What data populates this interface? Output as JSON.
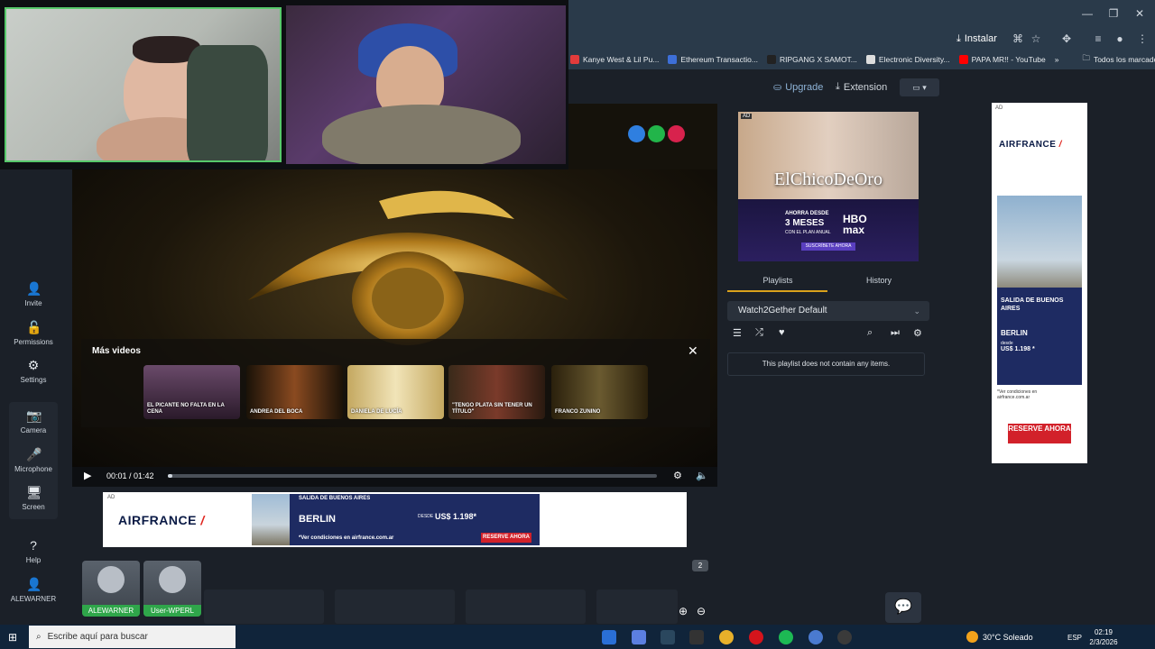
{
  "browser": {
    "install_label": "Instalar",
    "bookmarks": [
      {
        "label": "Kanye West & Lil Pu...",
        "color": "#e23b3b"
      },
      {
        "label": "Ethereum Transactio...",
        "color": "#3d6fd8"
      },
      {
        "label": "RIPGANG X SAMOT...",
        "color": "#222222"
      },
      {
        "label": "Electronic Diversity...",
        "color": "#dddddd"
      },
      {
        "label": "PAPA MR!! - YouTube",
        "color": "#ff0000"
      }
    ],
    "bookmarks_overflow": "»",
    "all_bookmarks_label": "Todos los marcadores"
  },
  "header": {
    "upgrade_label": "Upgrade",
    "extension_label": "Extension"
  },
  "sidebar": {
    "items": [
      {
        "label": "Invite",
        "icon": "add-user-icon",
        "glyph": "👤"
      },
      {
        "label": "Permissions",
        "icon": "lock-icon",
        "glyph": "🔓"
      },
      {
        "label": "Settings",
        "icon": "gear-icon",
        "glyph": "⚙"
      },
      {
        "label": "Camera",
        "icon": "camera-icon",
        "glyph": "📷"
      },
      {
        "label": "Microphone",
        "icon": "microphone-icon",
        "glyph": "🎤"
      },
      {
        "label": "Screen",
        "icon": "screen-icon",
        "glyph": "🖥"
      },
      {
        "label": "Help",
        "icon": "help-icon",
        "glyph": "?"
      },
      {
        "label": "ALEWARNER",
        "icon": "user-icon",
        "glyph": "👤"
      }
    ]
  },
  "video": {
    "more_videos_title": "Más videos",
    "thumbnails": [
      {
        "caption": "EL PICANTE NO FALTA EN LA CENA",
        "color": "#6a4a6a"
      },
      {
        "caption": "ANDREA DEL BOCA",
        "color": "#8a4a20"
      },
      {
        "caption": "DANIELA DE LUCÍA",
        "color": "#c4a860"
      },
      {
        "caption": "\"TENGO PLATA SIN TENER UN TÍTULO\"",
        "color": "#7a3a2a"
      },
      {
        "caption": "FRANCO ZUNINO",
        "color": "#6a5a30"
      }
    ],
    "current_time": "00:01",
    "duration": "01:42",
    "time_display": "00:01 / 01:42",
    "progress_fraction": 0.01
  },
  "ad_bottom": {
    "ad_label": "AD",
    "brand_text": "AIRFRANCE",
    "route": "SALIDA DE BUENOS AIRES",
    "city": "BERLIN",
    "price_prefix": "DESDE",
    "price": "US$ 1.198*",
    "conditions": "*Ver condiciones en airfrance.com.ar",
    "cta": "RESERVE AHORA"
  },
  "users": {
    "count": "2",
    "list": [
      {
        "name": "ALEWARNER"
      },
      {
        "name": "User-WPERL"
      }
    ]
  },
  "ad_hbo": {
    "ad_label": "AD",
    "title": "ElChicoDeOro",
    "offer_line1": "AHORRA DESDE",
    "offer_line2": "3 MESES",
    "offer_line3": "CON EL PLAN ANUAL",
    "brand": "HBO max",
    "cta": "SUSCRÍBETE AHORA"
  },
  "playlist_panel": {
    "tabs": [
      "Playlists",
      "History"
    ],
    "selected_playlist": "Watch2Gether Default",
    "empty_message": "This playlist does not contain any items."
  },
  "ad_side": {
    "ad_label": "AD",
    "brand_text": "AIRFRANCE",
    "route": "SALIDA DE BUENOS AIRES",
    "city": "BERLIN",
    "price_prefix": "desde",
    "price": "US$ 1.198 *",
    "conditions": "*Ver condiciones en airfrance.com.ar",
    "cta": "RESERVE AHORA"
  },
  "taskbar": {
    "search_placeholder": "Escribe aquí para buscar",
    "apps": [
      {
        "icon": "app-icon-1",
        "color": "#2a6fd6"
      },
      {
        "icon": "app-icon-2",
        "color": "#5c7fe0"
      },
      {
        "icon": "steam-icon",
        "color": "#2a475e"
      },
      {
        "icon": "epic-icon",
        "color": "#333333"
      },
      {
        "icon": "chrome-icon",
        "color": "#e8b02a"
      },
      {
        "icon": "opera-icon",
        "color": "#d4141c"
      },
      {
        "icon": "spotify-icon",
        "color": "#1db954"
      },
      {
        "icon": "chrome-profile-icon",
        "color": "#4a7acf"
      },
      {
        "icon": "obs-icon",
        "color": "#3a3a3a"
      }
    ],
    "weather": "30°C Soleado",
    "language": "ESP",
    "time": "02:19",
    "date": "2/3/2026"
  }
}
